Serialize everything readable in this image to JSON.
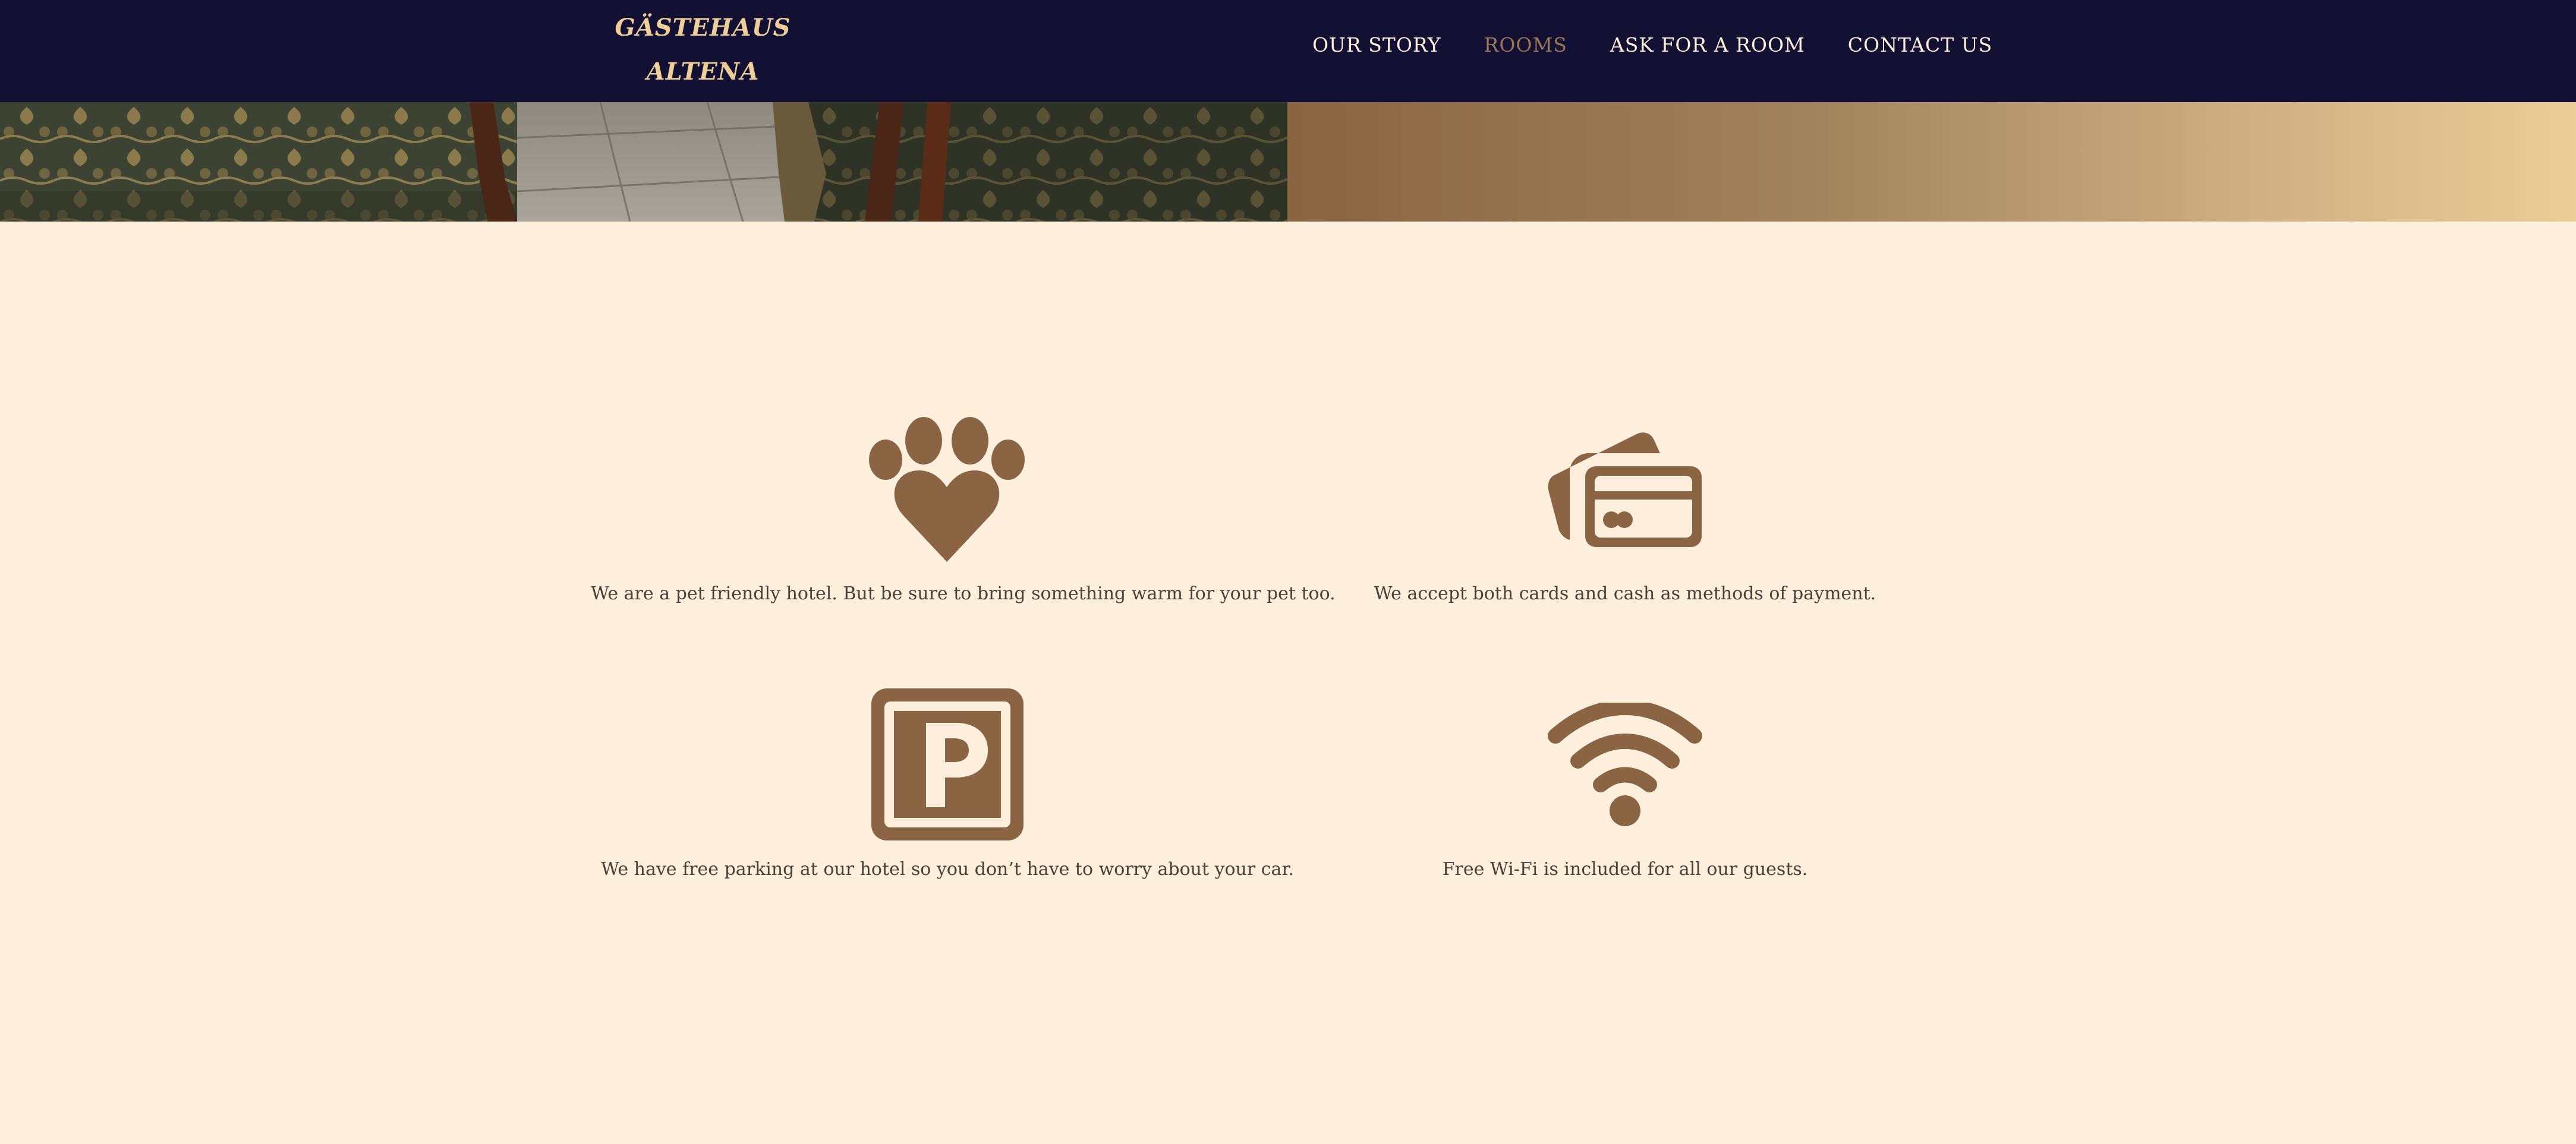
{
  "header": {
    "logo_line1": "GÄSTEHAUS",
    "logo_line2": "ALTENA",
    "nav": [
      {
        "label": "OUR STORY",
        "active": false
      },
      {
        "label": "ROOMS",
        "active": true
      },
      {
        "label": "ASK FOR A ROOM",
        "active": false
      },
      {
        "label": "CONTACT US",
        "active": false
      }
    ]
  },
  "amenities": [
    {
      "icon": "paw-heart-icon",
      "text": "We are a pet friendly hotel. But be sure to bring something warm for your pet too."
    },
    {
      "icon": "credit-card-icon",
      "text": "We accept both cards and cash as methods of payment."
    },
    {
      "icon": "parking-icon",
      "text": "We have free parking at our hotel so you don’t have to worry about your car."
    },
    {
      "icon": "wifi-icon",
      "text": "Free Wi-Fi is included for all our guests."
    }
  ],
  "colors": {
    "header_bg": "#121033",
    "logo": "#efcf99",
    "nav_text": "#fdefdc",
    "nav_active": "#9a7756",
    "page_bg": "#fdefdc",
    "icon": "#8a6443",
    "body_text": "#4a4036"
  }
}
